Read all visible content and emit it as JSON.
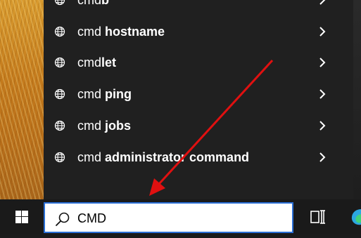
{
  "suggestions": [
    {
      "prefix": "cmd",
      "bold": "b",
      "icon": "globe-icon"
    },
    {
      "prefix": "cmd ",
      "bold": "hostname",
      "icon": "globe-icon"
    },
    {
      "prefix": "cmd",
      "bold": "let",
      "icon": "globe-icon"
    },
    {
      "prefix": "cmd ",
      "bold": "ping",
      "icon": "globe-icon"
    },
    {
      "prefix": "cmd ",
      "bold": "jobs",
      "icon": "globe-icon"
    },
    {
      "prefix": "cmd ",
      "bold": "administrator command",
      "icon": "globe-icon"
    }
  ],
  "search": {
    "value": "CMD",
    "icon": "search-icon"
  },
  "taskbar": {
    "start_icon": "windows-logo-icon",
    "taskview_icon": "task-view-icon"
  },
  "colors": {
    "accent": "#2b6fd6",
    "arrow": "#e01010",
    "panel": "#202020"
  }
}
